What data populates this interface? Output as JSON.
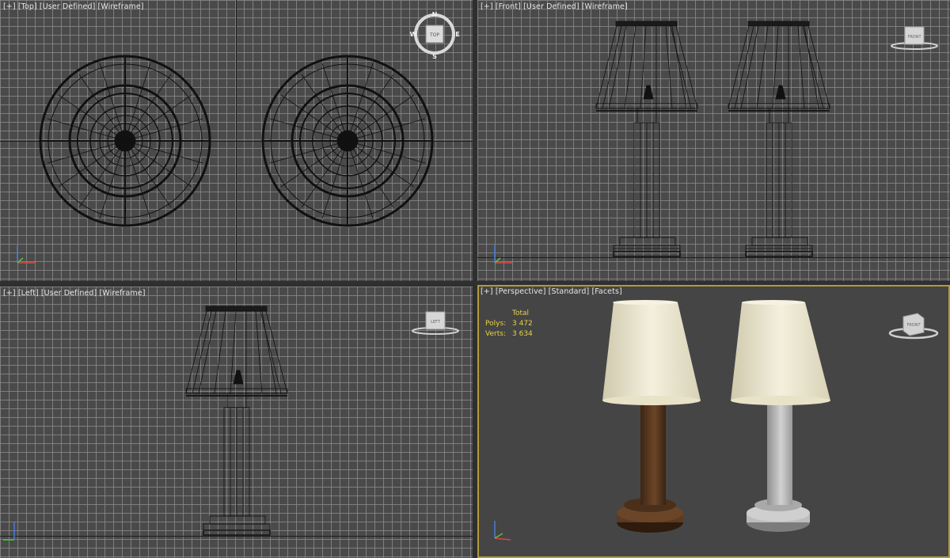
{
  "viewports": {
    "top": {
      "plus": "[+]",
      "view": "[Top]",
      "mode": "[User Defined]",
      "shading": "[Wireframe]",
      "compass": {
        "n": "N",
        "s": "S",
        "e": "E",
        "w": "W",
        "cube": "TOP"
      }
    },
    "front": {
      "plus": "[+]",
      "view": "[Front]",
      "mode": "[User Defined]",
      "shading": "[Wireframe]",
      "cube": "FRONT"
    },
    "left": {
      "plus": "[+]",
      "view": "[Left]",
      "mode": "[User Defined]",
      "shading": "[Wireframe]",
      "cube": "LEFT"
    },
    "perspective": {
      "plus": "[+]",
      "view": "[Perspective]",
      "mode": "[Standard]",
      "shading": "[Facets]",
      "cube": "FRONT",
      "stats": {
        "header": "Total",
        "polys_label": "Polys:",
        "polys_value": "3 472",
        "verts_label": "Verts:",
        "verts_value": "3 634"
      }
    }
  },
  "colors": {
    "viewport_bg": "#4a4a4a",
    "grid": "#878787",
    "wire": "#111111",
    "active_border": "#b39a3a",
    "stats_text": "#e7d24a",
    "shade": "#ece7cf",
    "wood": "#5a3a22",
    "grey_lamp": "#c4c4c4"
  }
}
